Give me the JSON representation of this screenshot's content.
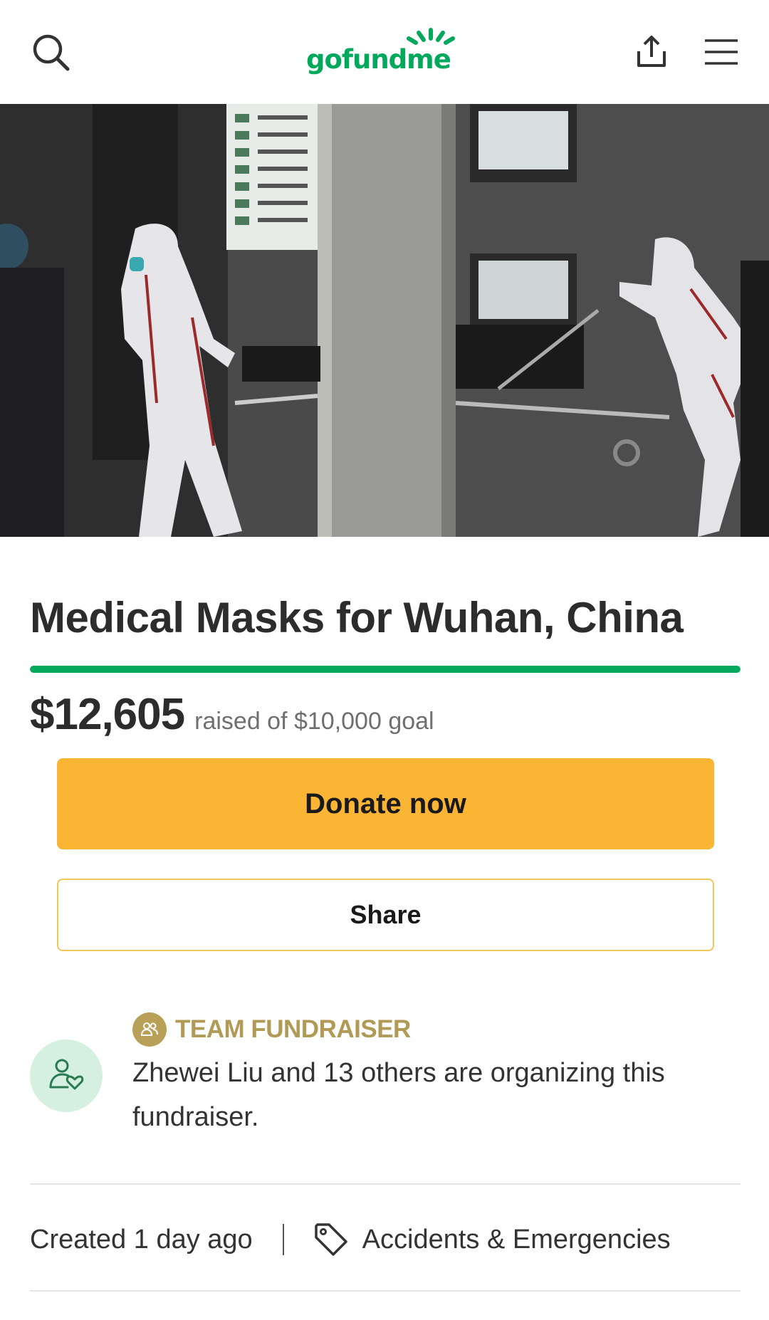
{
  "header": {
    "logo_text": "gofundme",
    "brand_color": "#02a95c",
    "icons": [
      "search-icon",
      "share-upload-icon",
      "hamburger-menu-icon"
    ]
  },
  "campaign": {
    "title": "Medical Masks for Wuhan, China",
    "progress_fraction": 1.0,
    "raised_amount": "$12,605",
    "goal_text": "raised of $10,000 goal"
  },
  "actions": {
    "donate_label": "Donate now",
    "share_label": "Share",
    "donate_color": "#fbb534"
  },
  "organizer": {
    "badge_label": "TEAM FUNDRAISER",
    "description": "Zhewei Liu and 13 others are organizing this fundraiser."
  },
  "meta": {
    "created": "Created 1 day ago",
    "category": "Accidents & Emergencies"
  }
}
